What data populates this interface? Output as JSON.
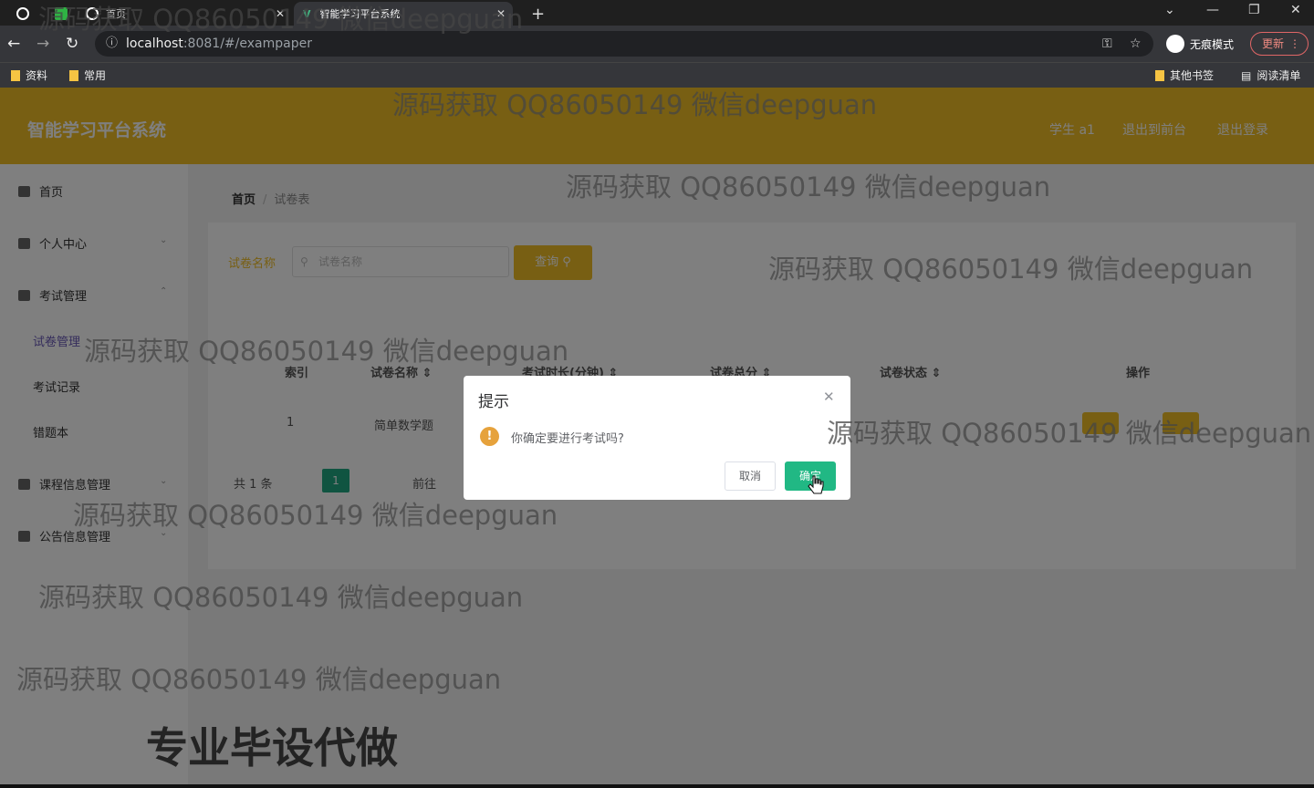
{
  "browser": {
    "tabs": [
      {
        "label": "首页",
        "active": false
      },
      {
        "label": "智能学习平台系统",
        "active": true
      }
    ],
    "url_host": "localhost",
    "url_path": ":8081/#/exampaper",
    "incognito_label": "无痕模式",
    "update_label": "更新",
    "bookmarks": [
      "资料",
      "常用"
    ],
    "bookmarks_right": [
      "其他书签",
      "阅读清单"
    ]
  },
  "app": {
    "title": "智能学习平台系统",
    "header_links": [
      "学生 a1",
      "退出到前台",
      "退出登录"
    ],
    "accent_color": "#f0bf26"
  },
  "sidebar": {
    "items": [
      {
        "label": "首页"
      },
      {
        "label": "个人中心"
      },
      {
        "label": "考试管理"
      },
      {
        "label": "课程信息管理"
      },
      {
        "label": "公告信息管理"
      }
    ],
    "sub_items": [
      "试卷管理",
      "考试记录",
      "错题本"
    ]
  },
  "breadcrumb": {
    "home": "首页",
    "current": "试卷表"
  },
  "search": {
    "label": "试卷名称",
    "placeholder": "试卷名称",
    "button": "查询"
  },
  "table": {
    "headers": [
      "索引",
      "试卷名称",
      "考试时长(分钟)",
      "试卷总分",
      "试卷状态",
      "操作"
    ],
    "rows": [
      {
        "index": "1",
        "name": "简单数学题"
      }
    ]
  },
  "pagination": {
    "total_text": "共 1 条",
    "current_page": "1",
    "goto_label": "前往"
  },
  "dialog": {
    "title": "提示",
    "message": "你确定要进行考试吗?",
    "cancel": "取消",
    "confirm": "确定",
    "confirm_color": "#21b884"
  },
  "watermark": {
    "text": "源码获取 QQ86050149 微信deepguan",
    "big_text": "专业毕设代做"
  }
}
